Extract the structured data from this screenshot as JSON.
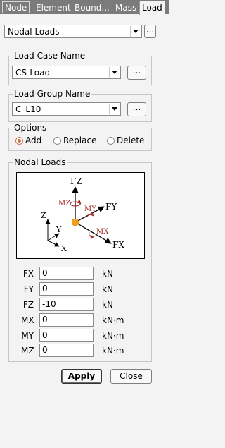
{
  "tabs": [
    {
      "label": "Node",
      "active": false
    },
    {
      "label": "Element",
      "active": false
    },
    {
      "label": "Bound...",
      "active": false
    },
    {
      "label": "Mass",
      "active": false
    },
    {
      "label": "Load",
      "active": true
    }
  ],
  "load_type": {
    "value": "Nodal Loads",
    "more": "..."
  },
  "load_case": {
    "label": "Load Case Name",
    "value": "CS-Load",
    "more": "..."
  },
  "load_group": {
    "label": "Load Group Name",
    "value": "C_L10",
    "more": "..."
  },
  "options": {
    "label": "Options",
    "items": [
      {
        "label": "Add",
        "checked": true
      },
      {
        "label": "Replace",
        "checked": false
      },
      {
        "label": "Delete",
        "checked": false
      }
    ]
  },
  "nodal_loads": {
    "label": "Nodal Loads",
    "diagram": {
      "axis_labels": {
        "z": "Z",
        "y": "Y",
        "x": "X"
      },
      "force_labels": {
        "fz": "FZ",
        "fy": "FY",
        "fx": "FX"
      },
      "moment_labels": {
        "mz": "MZ",
        "my": "MY",
        "mx": "MX"
      },
      "colors": {
        "force": "#000000",
        "moment": "#a0302a",
        "node": "#f5a01a"
      }
    },
    "fields": [
      {
        "label": "FX",
        "value": "0",
        "unit": "kN"
      },
      {
        "label": "FY",
        "value": "0",
        "unit": "kN"
      },
      {
        "label": "FZ",
        "value": "-10",
        "unit": "kN"
      },
      {
        "label": "MX",
        "value": "0",
        "unit": "kN·m"
      },
      {
        "label": "MY",
        "value": "0",
        "unit": "kN·m"
      },
      {
        "label": "MZ",
        "value": "0",
        "unit": "kN·m"
      }
    ]
  },
  "actions": {
    "apply": {
      "label": "Apply",
      "mnemonic": "A"
    },
    "close": {
      "label": "Close",
      "mnemonic": "C"
    }
  }
}
